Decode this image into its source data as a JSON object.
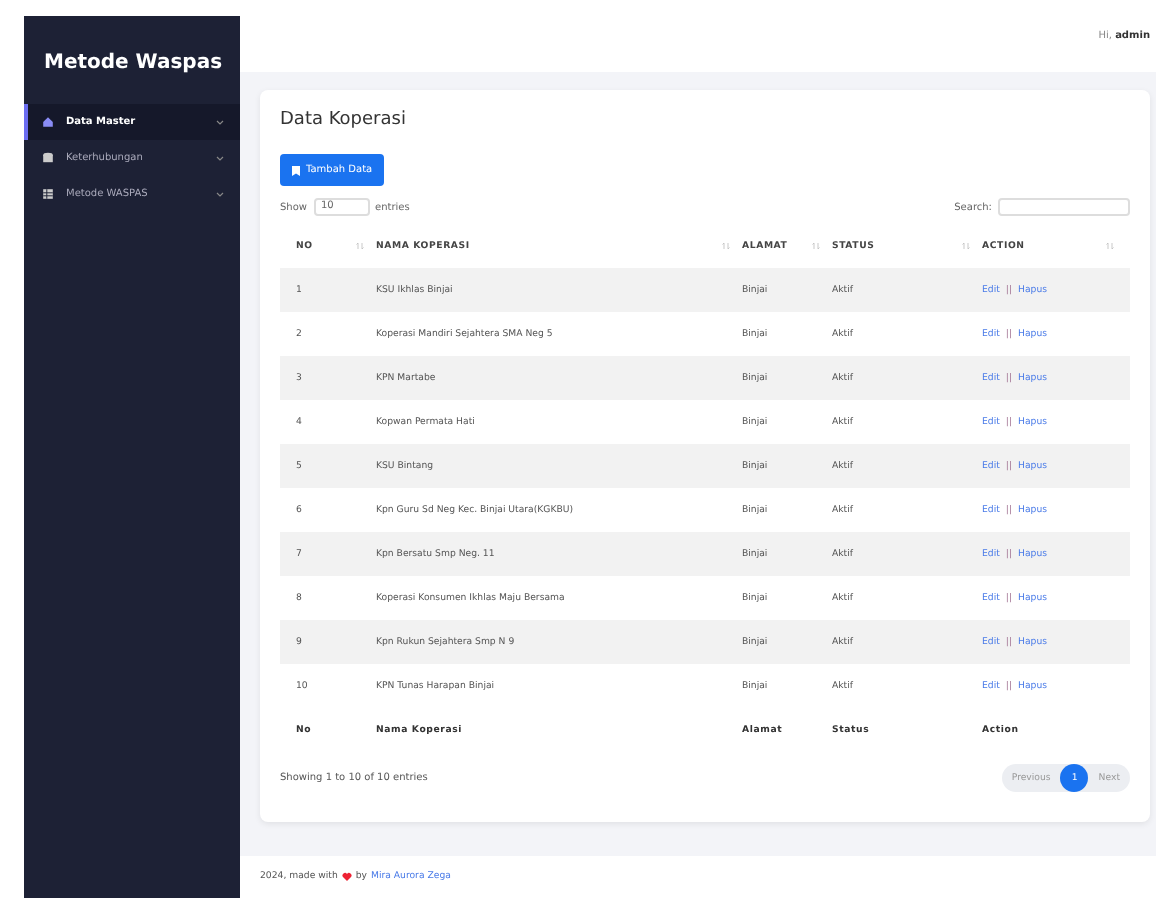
{
  "sidebar": {
    "brand": "Metode Waspas",
    "items": [
      {
        "label": "Data Master",
        "selected": true
      },
      {
        "label": "Keterhubungan",
        "selected": false
      },
      {
        "label": "Metode WASPAS",
        "selected": false
      }
    ]
  },
  "topbar": {
    "greeting": "Hi,",
    "user": "admin"
  },
  "card": {
    "title": "Data Koperasi",
    "add_button": "Tambah Data",
    "show_label": "Show",
    "show_value": "10",
    "entries_label": "entries",
    "search_label": "Search:",
    "columns": [
      "NO",
      "NAMA KOPERASI",
      "ALAMAT",
      "STATUS",
      "ACTION"
    ],
    "rows": [
      {
        "no": "1",
        "nama": "KSU Ikhlas Binjai",
        "alamat": "Binjai",
        "status": "Aktif",
        "edit": "Edit",
        "separator": "||",
        "delete": "Hapus"
      },
      {
        "no": "2",
        "nama": "Koperasi Mandiri Sejahtera SMA Neg 5",
        "alamat": "Binjai",
        "status": "Aktif",
        "edit": "Edit",
        "separator": "||",
        "delete": "Hapus"
      },
      {
        "no": "3",
        "nama": "KPN Martabe",
        "alamat": "Binjai",
        "status": "Aktif",
        "edit": "Edit",
        "separator": "||",
        "delete": "Hapus"
      },
      {
        "no": "4",
        "nama": "Kopwan Permata Hati",
        "alamat": "Binjai",
        "status": "Aktif",
        "edit": "Edit",
        "separator": "||",
        "delete": "Hapus"
      },
      {
        "no": "5",
        "nama": "KSU Bintang",
        "alamat": "Binjai",
        "status": "Aktif",
        "edit": "Edit",
        "separator": "||",
        "delete": "Hapus"
      },
      {
        "no": "6",
        "nama": "Kpn Guru Sd Neg Kec. Binjai Utara(KGKBU)",
        "alamat": "Binjai",
        "status": "Aktif",
        "edit": "Edit",
        "separator": "||",
        "delete": "Hapus"
      },
      {
        "no": "7",
        "nama": "Kpn Bersatu Smp Neg. 11",
        "alamat": "Binjai",
        "status": "Aktif",
        "edit": "Edit",
        "separator": "||",
        "delete": "Hapus"
      },
      {
        "no": "8",
        "nama": "Koperasi Konsumen Ikhlas Maju Bersama",
        "alamat": "Binjai",
        "status": "Aktif",
        "edit": "Edit",
        "separator": "||",
        "delete": "Hapus"
      },
      {
        "no": "9",
        "nama": "Kpn Rukun Sejahtera Smp N 9",
        "alamat": "Binjai",
        "status": "Aktif",
        "edit": "Edit",
        "separator": "||",
        "delete": "Hapus"
      },
      {
        "no": "10",
        "nama": "KPN Tunas Harapan Binjai",
        "alamat": "Binjai",
        "status": "Aktif",
        "edit": "Edit",
        "separator": "||",
        "delete": "Hapus"
      }
    ],
    "footer_columns": [
      "No",
      "Nama Koperasi",
      "Alamat",
      "Status",
      "Action"
    ],
    "info": "Showing 1 to 10 of 10 entries",
    "pagination": [
      {
        "label": "Previous",
        "selected": false
      },
      {
        "label": "1",
        "selected": true
      },
      {
        "label": "Next",
        "selected": false
      }
    ]
  },
  "footer": {
    "prefix": "2024, made with",
    "by": "by",
    "author": "Mira Aurora Zega"
  }
}
